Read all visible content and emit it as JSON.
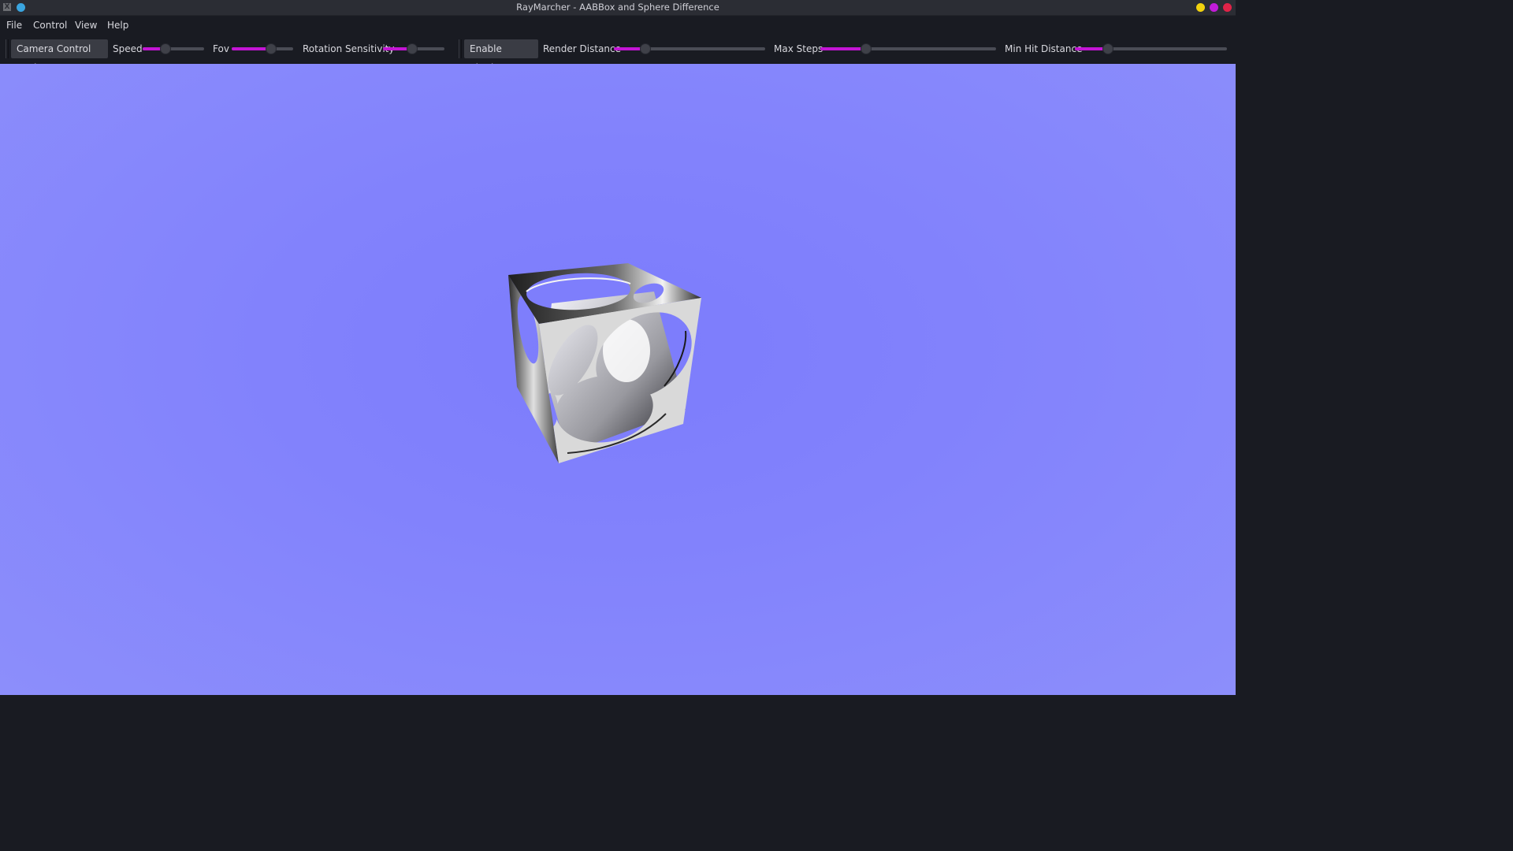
{
  "window": {
    "title": "RayMarcher - AABBox and Sphere Difference",
    "app_icon": "x-app-icon",
    "buttons": [
      "minimize",
      "maximize",
      "close"
    ],
    "colors": {
      "minimize": "#f2d20e",
      "maximize": "#c21cd8",
      "close": "#e02348"
    }
  },
  "menu": {
    "file": "File",
    "control": "Control",
    "view": "View",
    "help": "Help"
  },
  "toolbar": {
    "camera_mode_label": "Camera Control Mode",
    "speed_label": "Speed",
    "speed_value": 0.37,
    "fov_label": "Fov",
    "fov_value": 0.64,
    "rotation_label": "Rotation Sensitivity",
    "rotation_value": 0.47,
    "shadows_label": "Enable Shadows",
    "render_distance_label": "Render Distance",
    "render_distance_value": 0.21,
    "max_steps_label": "Max Steps",
    "max_steps_value": 0.26,
    "min_hit_label": "Min Hit Distance",
    "min_hit_value": 0.22,
    "accent_color": "#c415d5"
  },
  "viewport": {
    "background_color": "#8282fc",
    "object": "box with spherical cut-outs (AABBox minus sphere)"
  }
}
